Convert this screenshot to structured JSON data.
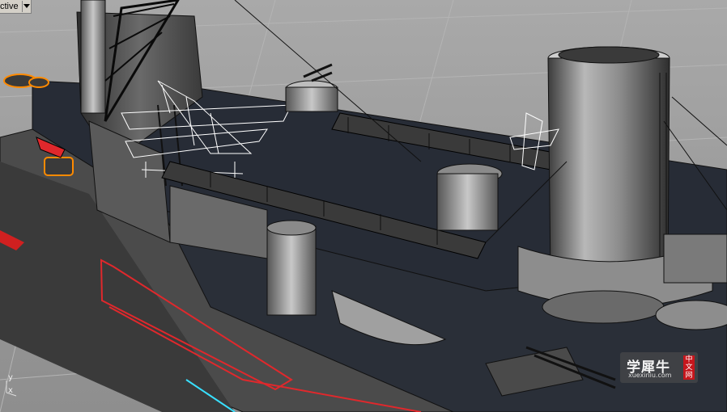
{
  "viewport": {
    "title": "ctive",
    "dropdown_icon": "chevron-down-icon"
  },
  "axes": {
    "y_label": "y",
    "x_label": "x"
  },
  "watermark": {
    "main_text": "学犀牛",
    "sub_text": "xuexiniu.com",
    "badge_text": "中文网"
  },
  "colors": {
    "background": "#9c9c9c",
    "hull": "#4a4a4a",
    "deck": "#2a2f38",
    "selection": "#ff8a00",
    "highlight_red": "#e0282c",
    "wire_white": "#ffffff"
  }
}
